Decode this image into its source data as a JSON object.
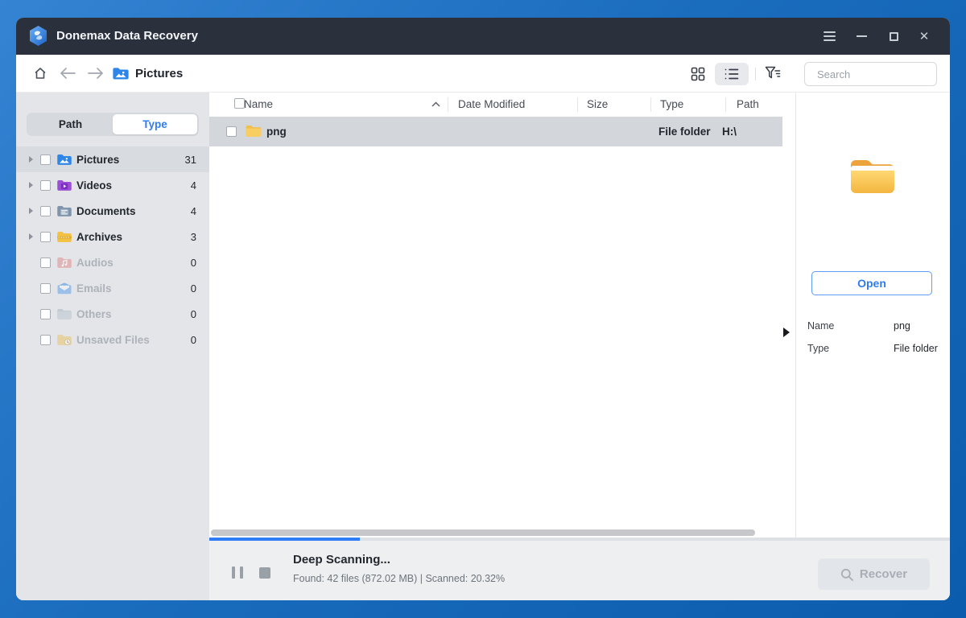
{
  "window": {
    "title": "Donemax Data Recovery"
  },
  "toolbar": {
    "breadcrumb": "Pictures",
    "search_placeholder": "Search"
  },
  "sidebar": {
    "tabs": [
      {
        "label": "Path",
        "active": false
      },
      {
        "label": "Type",
        "active": true
      }
    ],
    "items": [
      {
        "label": "Pictures",
        "count": "31",
        "enabled": true,
        "selected": true,
        "icon": "pictures-folder-icon"
      },
      {
        "label": "Videos",
        "count": "4",
        "enabled": true,
        "selected": false,
        "icon": "videos-folder-icon"
      },
      {
        "label": "Documents",
        "count": "4",
        "enabled": true,
        "selected": false,
        "icon": "documents-folder-icon"
      },
      {
        "label": "Archives",
        "count": "3",
        "enabled": true,
        "selected": false,
        "icon": "archives-folder-icon"
      },
      {
        "label": "Audios",
        "count": "0",
        "enabled": false,
        "selected": false,
        "icon": "audios-folder-icon"
      },
      {
        "label": "Emails",
        "count": "0",
        "enabled": false,
        "selected": false,
        "icon": "emails-icon"
      },
      {
        "label": "Others",
        "count": "0",
        "enabled": false,
        "selected": false,
        "icon": "others-folder-icon"
      },
      {
        "label": "Unsaved Files",
        "count": "0",
        "enabled": false,
        "selected": false,
        "icon": "unsaved-files-icon"
      }
    ]
  },
  "table": {
    "columns": [
      "Name",
      "Date Modified",
      "Size",
      "Type",
      "Path"
    ],
    "sort_column": "Name",
    "rows": [
      {
        "name": "png",
        "date_modified": "",
        "size": "",
        "type": "File folder",
        "path": "H:\\",
        "selected": true
      }
    ]
  },
  "preview": {
    "open_label": "Open",
    "details": [
      {
        "label": "Name",
        "value": "png"
      },
      {
        "label": "Type",
        "value": "File folder"
      }
    ]
  },
  "statusbar": {
    "status_title": "Deep Scanning...",
    "status_detail": "Found: 42 files (872.02 MB) | Scanned: 20.32%",
    "recover_label": "Recover",
    "progress_percent": 20.32
  },
  "colors": {
    "accent_blue": "#2e7cf6",
    "titlebar": "#2b313c",
    "sidebar_bg": "#e3e5e9",
    "selected_row": "#d3d6db",
    "frame_gradient_start": "#3583d3",
    "frame_gradient_end": "#0c5cad",
    "disabled_text": "#aeb3ba"
  }
}
